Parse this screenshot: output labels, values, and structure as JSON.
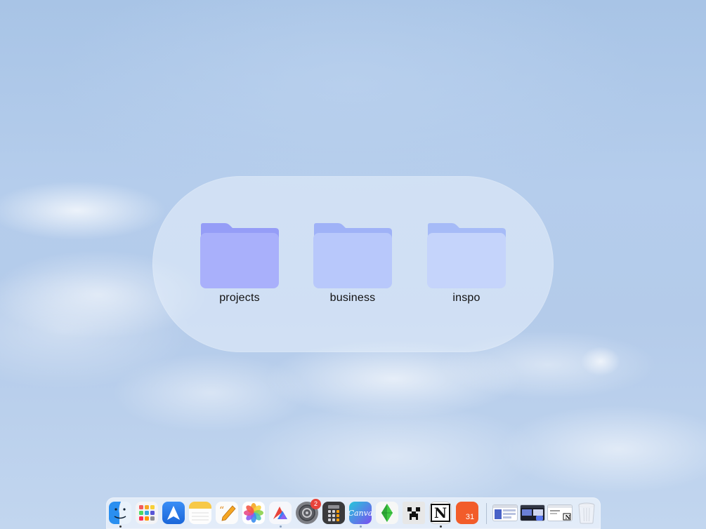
{
  "folders": [
    {
      "label": "projects",
      "icon": "folder-icon",
      "color": "#a9b0fb",
      "tab_color": "#959df7"
    },
    {
      "label": "business",
      "icon": "folder-icon",
      "color": "#b8c8fb",
      "tab_color": "#9fb2f7"
    },
    {
      "label": "inspo",
      "icon": "folder-icon",
      "color": "#c5d4fb",
      "tab_color": "#a6bbf7"
    }
  ],
  "dock": {
    "apps": [
      {
        "name": "Finder",
        "icon": "finder-icon",
        "running": true
      },
      {
        "name": "Launchpad",
        "icon": "launchpad-icon",
        "running": false
      },
      {
        "name": "Spark",
        "icon": "spark-mail-icon",
        "running": false
      },
      {
        "name": "Notes",
        "icon": "notes-icon",
        "running": false
      },
      {
        "name": "Pages",
        "icon": "pages-icon",
        "running": false
      },
      {
        "name": "Photos",
        "icon": "photos-icon",
        "running": false
      },
      {
        "name": "Affinity",
        "icon": "affinity-icon",
        "running": true
      },
      {
        "name": "System Preferences",
        "icon": "system-preferences-icon",
        "running": false,
        "badge": "2"
      },
      {
        "name": "Calculator",
        "icon": "calculator-icon",
        "running": false
      },
      {
        "name": "Canva",
        "icon": "canva-icon",
        "label": "Canva",
        "running": true
      },
      {
        "name": "The Sims",
        "icon": "plumbob-icon",
        "running": false
      },
      {
        "name": "Minecraft",
        "icon": "creeper-icon",
        "running": false
      },
      {
        "name": "Notion",
        "icon": "notion-icon",
        "label": "N",
        "running": true
      },
      {
        "name": "Fantastical",
        "icon": "calendar-icon",
        "label": "31",
        "running": false
      }
    ],
    "minimized": [
      {
        "icon": "window-thumbnail-icon"
      },
      {
        "icon": "window-thumbnail-icon"
      },
      {
        "icon": "window-thumbnail-icon"
      }
    ],
    "trash": {
      "icon": "trash-icon"
    }
  }
}
